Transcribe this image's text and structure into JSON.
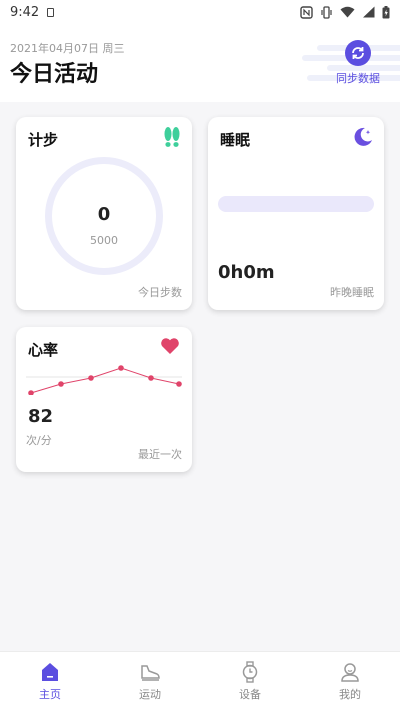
{
  "status_bar": {
    "time": "9:42",
    "icons": [
      "sim-card-icon",
      "nfc-icon",
      "vibrate-icon",
      "wifi-icon",
      "cellular-signal-icon",
      "battery-icon"
    ]
  },
  "header": {
    "date": "2021年04月07日 周三",
    "title": "今日活动",
    "sync_label": "同步数据"
  },
  "steps_card": {
    "title": "计步",
    "value": "0",
    "goal": "5000",
    "footer": "今日步数",
    "progress": 0
  },
  "sleep_card": {
    "title": "睡眠",
    "value": "0h0m",
    "footer": "昨晚睡眠"
  },
  "heart_card": {
    "title": "心率",
    "value": "82",
    "unit": "次/分",
    "footer": "最近一次",
    "trend_points": 6
  },
  "tabs": [
    {
      "label": "主页",
      "icon": "home-icon",
      "active": true
    },
    {
      "label": "运动",
      "icon": "shoe-icon",
      "active": false
    },
    {
      "label": "设备",
      "icon": "watch-icon",
      "active": false
    },
    {
      "label": "我的",
      "icon": "profile-icon",
      "active": false
    }
  ],
  "colors": {
    "accent": "#5b4ee0",
    "steps_icon": "#3ecf9b",
    "heart": "#e0446a",
    "sleep_bar": "#eae8fb",
    "ring_track": "#ececfa"
  }
}
